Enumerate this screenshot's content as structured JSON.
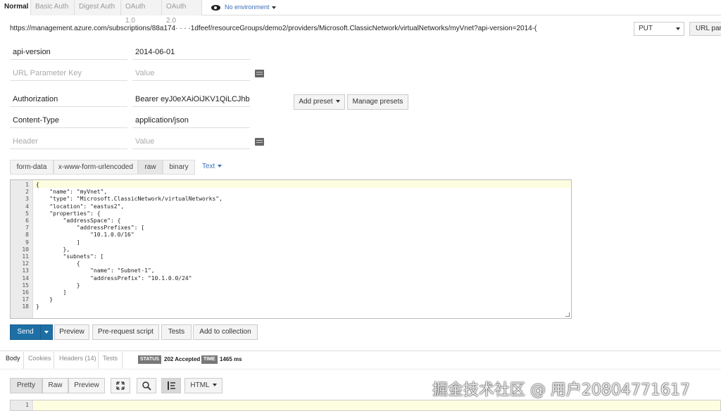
{
  "auth_tabs": [
    "Normal",
    "Basic Auth",
    "Digest Auth",
    "OAuth 1.0",
    "OAuth 2.0"
  ],
  "environment": "No environment",
  "url": "https://management.azure.com/subscriptions/88a174· ·           ·          ·1dfeef/resourceGroups/demo2/providers/Microsoft.ClassicNetwork/virtualNetworks/myVnet?api-version=2014-(",
  "method": "PUT",
  "url_params_button": "URL par",
  "params": [
    {
      "key": "api-version",
      "value": "2014-06-01"
    },
    {
      "key": "URL Parameter Key",
      "value": "Value"
    }
  ],
  "headers": [
    {
      "key": "Authorization",
      "value": "Bearer eyJ0eXAiOiJKV1QiLCJhbG"
    },
    {
      "key": "Content-Type",
      "value": "application/json"
    },
    {
      "key": "Header",
      "value": "Value"
    }
  ],
  "preset": {
    "add": "Add preset",
    "manage": "Manage presets"
  },
  "body_modes": [
    "form-data",
    "x-www-form-urlencoded",
    "raw",
    "binary"
  ],
  "body_type": "Text",
  "body_lines": [
    "{",
    "    \"name\": \"myVnet\",",
    "    \"type\": \"Microsoft.ClassicNetwork/virtualNetworks\",",
    "    \"location\": \"eastus2\",",
    "    \"properties\": {",
    "        \"addressSpace\": {",
    "            \"addressPrefixes\": [",
    "                \"10.1.0.0/16\"",
    "            ]",
    "        },",
    "        \"subnets\": [",
    "            {",
    "                \"name\": \"Subnet-1\",",
    "                \"addressPrefix\": \"10.1.0.0/24\"",
    "            }",
    "        ]",
    "    }",
    "}"
  ],
  "actions": {
    "send": "Send",
    "preview": "Preview",
    "prerequest": "Pre-request script",
    "tests": "Tests",
    "add_collection": "Add to collection"
  },
  "response": {
    "tabs": [
      "Body",
      "Cookies",
      "Headers (14)",
      "Tests"
    ],
    "status_label": "STATUS",
    "status": "202 Accepted",
    "time_label": "TIME",
    "time": "1465 ms",
    "views": [
      "Pretty",
      "Raw",
      "Preview"
    ],
    "format": "HTML",
    "line": "1"
  },
  "watermark": "掘金技术社区 @ 用户20804771617",
  "icons": [
    "eye-icon",
    "expand-icon",
    "search-icon",
    "wrap-icon",
    "edit-icon"
  ]
}
